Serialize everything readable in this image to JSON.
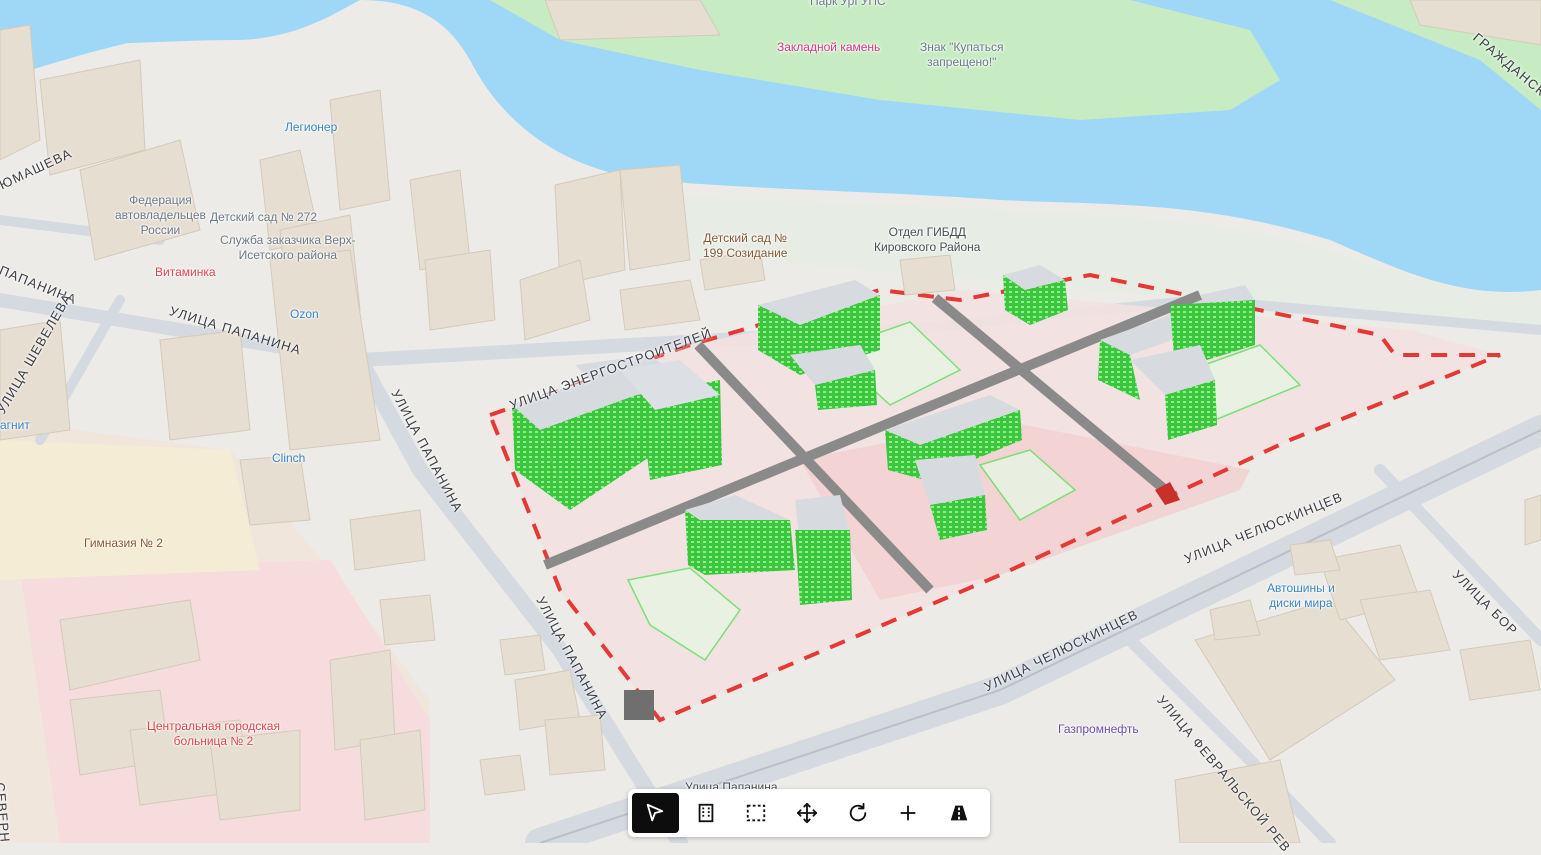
{
  "map": {
    "pois": [
      {
        "id": "park",
        "text": "Парк УрГУПС",
        "cls": "poi-grey"
      },
      {
        "id": "zaklad",
        "text": "Закладной камень",
        "cls": "poi-pink"
      },
      {
        "id": "znak",
        "text": "Знак \"Купаться\nзапрещено!\"",
        "cls": "poi-grey"
      },
      {
        "id": "legioner",
        "text": "Легионер",
        "cls": "poi-blue"
      },
      {
        "id": "federacia",
        "text": "Федерация\nавтовладельцев\nРоссии",
        "cls": "poi-grey"
      },
      {
        "id": "detsad272",
        "text": "Детский сад № 272",
        "cls": "poi-grey"
      },
      {
        "id": "sluzhba",
        "text": "Служба заказчика Верх-\nИсетского района",
        "cls": "poi-grey"
      },
      {
        "id": "vitaminka",
        "text": "Витаминка",
        "cls": "poi-red"
      },
      {
        "id": "ozon",
        "text": "Ozon",
        "cls": "poi-blue"
      },
      {
        "id": "clinch",
        "text": "Clinch",
        "cls": "poi-blue"
      },
      {
        "id": "gimnazia",
        "text": "Гимназия № 2",
        "cls": "poi-brown"
      },
      {
        "id": "bolnica",
        "text": "Центральная городская\nбольница № 2",
        "cls": "poi-red"
      },
      {
        "id": "detsad199",
        "text": "Детский сад №\n199 Созидание",
        "cls": "poi-brown"
      },
      {
        "id": "gibdd",
        "text": "Отдел ГИБДД\nКировского Района",
        "cls": "poi-dark"
      },
      {
        "id": "avtoshiny",
        "text": "Автошины и\nдиски мира",
        "cls": "poi-blue"
      },
      {
        "id": "gazprom",
        "text": "Газпромнефть",
        "cls": "poi-violet"
      },
      {
        "id": "metro",
        "text": "Улица Папанина",
        "cls": "poi-dark"
      },
      {
        "id": "magnit",
        "text": "агнит",
        "cls": "poi-blue"
      }
    ],
    "streets": [
      {
        "id": "papanina-top",
        "text": "ПАПАНИНА"
      },
      {
        "id": "papanina-mid",
        "text": "УЛИЦА ПАПАНИНА"
      },
      {
        "id": "papanina-v1",
        "text": "УЛИЦА ПАПАНИНА"
      },
      {
        "id": "papanina-v2",
        "text": "УЛИЦА ПАПАНИНА"
      },
      {
        "id": "shevelev",
        "text": "УЛИЦА ШЕВЕЛЕВА"
      },
      {
        "id": "energo",
        "text": "УЛИЦА ЭНЕРГОСТРОИТЕЛЕЙ"
      },
      {
        "id": "chel1",
        "text": "УЛИЦА ЧЕЛЮСКИНЦЕВ"
      },
      {
        "id": "chel2",
        "text": "УЛИЦА ЧЕЛЮСКИНЦЕВ"
      },
      {
        "id": "fevral",
        "text": "УЛИЦА ФЕВРАЛЬСКОЙ РЕВ"
      },
      {
        "id": "grazhd",
        "text": "ГРАЖДАНСК"
      },
      {
        "id": "bor",
        "text": "УЛИЦА БОР"
      },
      {
        "id": "mashova",
        "text": "ЮМАШЕВА"
      },
      {
        "id": "severn",
        "text": "СЕВЕРН"
      }
    ],
    "colors": {
      "water": "#9fd8f7",
      "park": "#c7ecc3",
      "building": "#e8e0d3",
      "site": "#e53935",
      "tower": "#58d35a",
      "road": "#8a8a8a"
    }
  },
  "toolbar": {
    "tools": [
      {
        "name": "select-tool",
        "icon": "cursor-icon",
        "active": true
      },
      {
        "name": "building-tool",
        "icon": "building-icon",
        "active": false
      },
      {
        "name": "area-select-tool",
        "icon": "dashed-square-icon",
        "active": false
      },
      {
        "name": "move-tool",
        "icon": "move-arrows-icon",
        "active": false
      },
      {
        "name": "rotate-tool",
        "icon": "rotate-icon",
        "active": false
      },
      {
        "name": "add-tool",
        "icon": "plus-icon",
        "active": false
      },
      {
        "name": "road-tool",
        "icon": "road-icon",
        "active": false
      }
    ]
  }
}
